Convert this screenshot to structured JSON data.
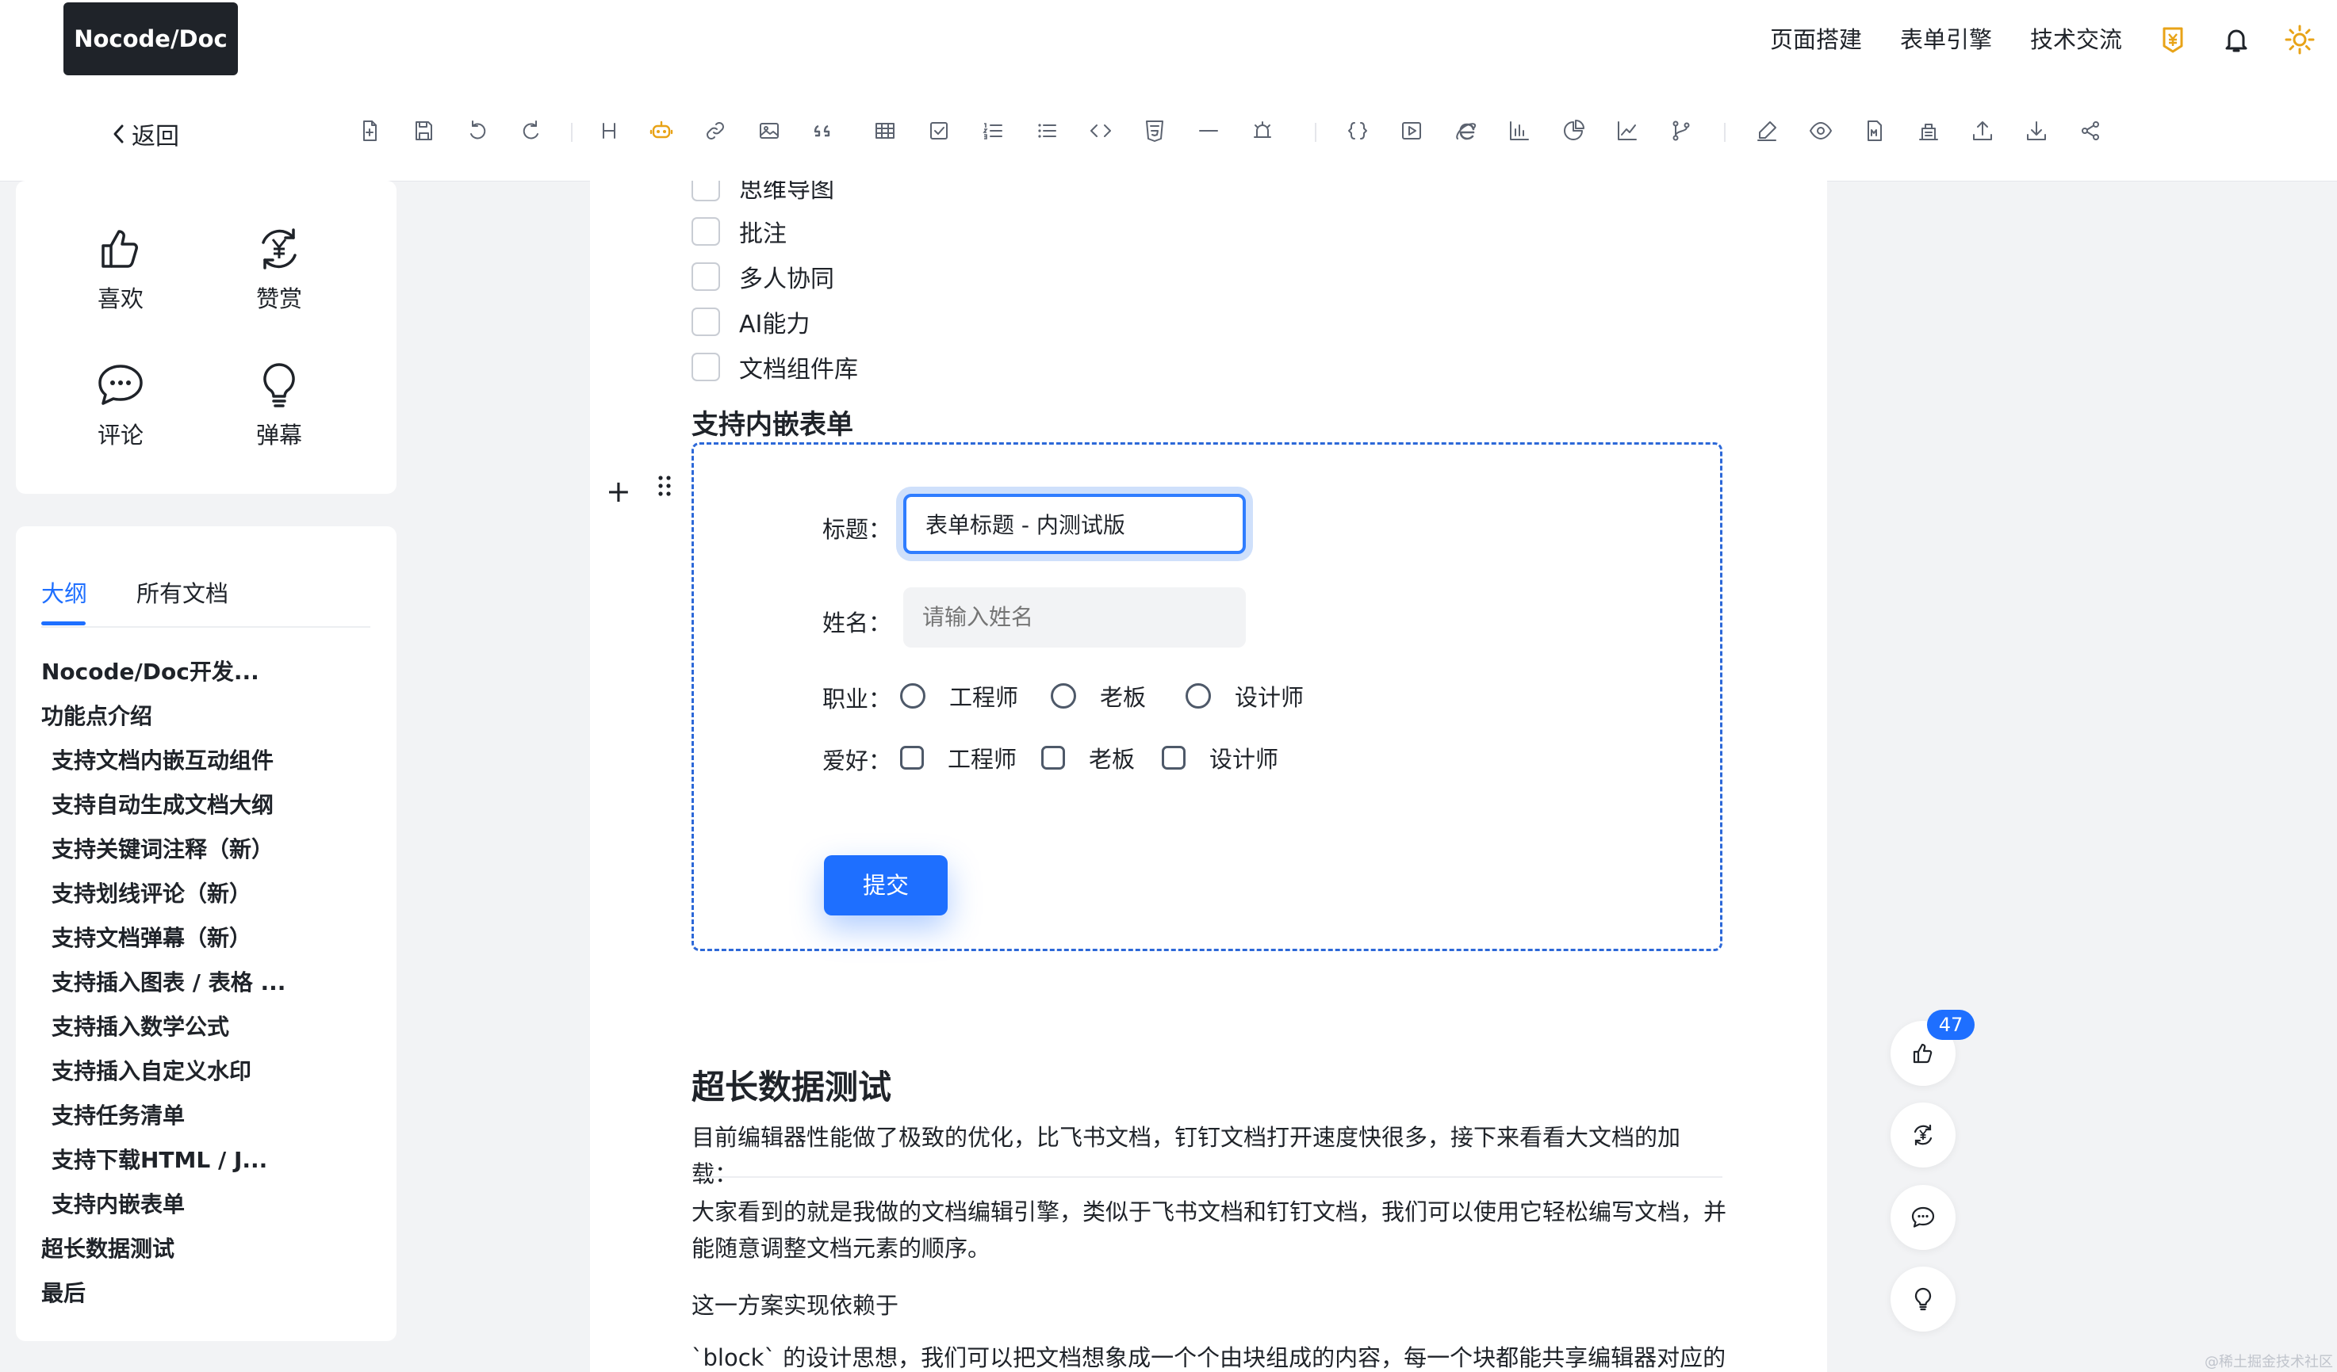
{
  "header": {
    "logo": "Nocode/Doc",
    "nav": [
      "页面搭建",
      "表单引擎",
      "技术交流"
    ],
    "icons": [
      "vip-coin-icon",
      "bell-icon",
      "sun-icon"
    ],
    "accent_color": "#1e6fff",
    "vip_color": "#e8a317"
  },
  "toolbar": {
    "back_label": "返回",
    "tools": [
      "new-doc-icon",
      "save-icon",
      "undo-icon",
      "redo-icon",
      "heading-icon",
      "ai-robot-icon",
      "link-icon",
      "image-icon",
      "quote-icon",
      "table-icon",
      "task-icon",
      "ordered-list-icon",
      "bullet-list-icon",
      "code-icon",
      "html-icon",
      "divider-icon",
      "alert-icon",
      "formula-icon",
      "video-icon",
      "browser-icon",
      "bar-chart-icon",
      "pie-chart-icon",
      "line-chart-icon",
      "branch-icon",
      "sign-icon",
      "preview-icon",
      "markdown-icon",
      "template-icon",
      "upload-icon",
      "download-icon",
      "share-icon"
    ]
  },
  "sidebar": {
    "actions": [
      {
        "label": "喜欢",
        "icon": "thumbs-up-icon"
      },
      {
        "label": "赞赏",
        "icon": "reward-icon"
      },
      {
        "label": "评论",
        "icon": "comment-icon"
      },
      {
        "label": "弹幕",
        "icon": "lightbulb-icon"
      }
    ],
    "tabs": [
      "大纲",
      "所有文档"
    ],
    "outline": [
      {
        "label": "Nocode/Doc开发...",
        "level": 1
      },
      {
        "label": "功能点介绍",
        "level": 1
      },
      {
        "label": "支持文档内嵌互动组件",
        "level": 2
      },
      {
        "label": "支持自动生成文档大纲",
        "level": 2
      },
      {
        "label": "支持关键词注释（新）",
        "level": 2
      },
      {
        "label": "支持划线评论（新）",
        "level": 2
      },
      {
        "label": "支持文档弹幕（新）",
        "level": 2
      },
      {
        "label": "支持插入图表 / 表格 ...",
        "level": 2
      },
      {
        "label": "支持插入数学公式",
        "level": 2
      },
      {
        "label": "支持插入自定义水印",
        "level": 2
      },
      {
        "label": "支持任务清单",
        "level": 2
      },
      {
        "label": "支持下载HTML / J...",
        "level": 2
      },
      {
        "label": "支持内嵌表单",
        "level": 2
      },
      {
        "label": "超长数据测试",
        "level": 1
      },
      {
        "label": "最后",
        "level": 1
      }
    ]
  },
  "doc": {
    "checklist": [
      "思维导图",
      "批注",
      "多人协同",
      "AI能力",
      "文档组件库"
    ],
    "section_title": "支持内嵌表单",
    "form": {
      "title_label": "标题：",
      "title_value": "表单标题 - 内测试版",
      "name_label": "姓名：",
      "name_placeholder": "请输入姓名",
      "job_label": "职业：",
      "job_options": [
        "工程师",
        "老板",
        "设计师"
      ],
      "hobby_label": "爱好：",
      "hobby_options": [
        "工程师",
        "老板",
        "设计师"
      ],
      "submit": "提交"
    },
    "h2": "超长数据测试",
    "paragraphs": [
      "目前编辑器性能做了极致的优化，比飞书文档，钉钉文档打开速度快很多，接下来看看大文档的加载：",
      "大家看到的就是我做的文档编辑引擎，类似于飞书文档和钉钉文档，我们可以使用它轻松编写文档，并能随意调整文档元素的顺序。",
      "这一方案实现依赖于",
      "`block` 的设计思想，我们可以把文档想象成一个个由块组成的内容，每一个块都能共享编辑器对应的"
    ]
  },
  "floating": {
    "like_count": "47",
    "buttons": [
      "thumbs-up-icon",
      "reward-icon",
      "comment-icon",
      "lightbulb-icon"
    ]
  },
  "watermark": "@稀土掘金技术社区"
}
